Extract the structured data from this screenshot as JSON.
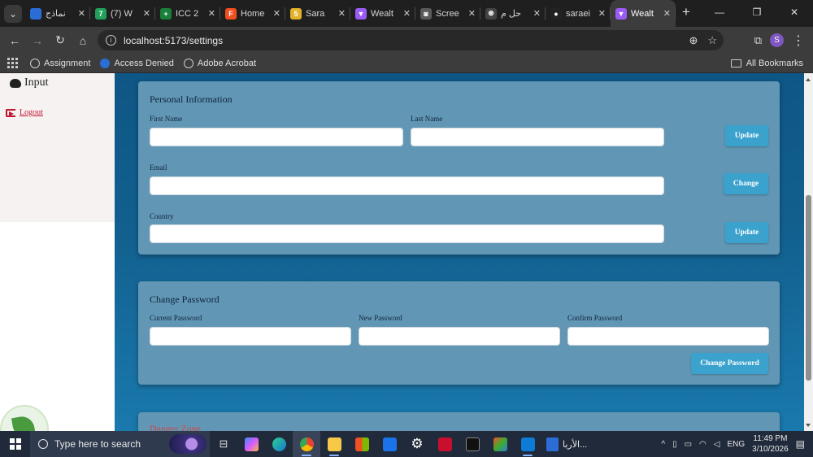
{
  "browser": {
    "tabs": [
      {
        "title": "نماذج",
        "favicon_color": "#2b6cd6",
        "favicon": "",
        "active": false
      },
      {
        "title": "(7) W",
        "favicon_color": "#22a05a",
        "favicon": "7",
        "active": false
      },
      {
        "title": "ICC 2",
        "favicon_color": "#188038",
        "favicon": "+",
        "active": false
      },
      {
        "title": "Home",
        "favicon_color": "#f24e1e",
        "favicon": "F",
        "active": false
      },
      {
        "title": "Sara",
        "favicon_color": "#e3b22a",
        "favicon": "5",
        "active": false
      },
      {
        "title": "Wealt",
        "favicon_color": "#9b5cf6",
        "favicon": "▼",
        "active": false
      },
      {
        "title": "Scree",
        "favicon_color": "#5a5a5a",
        "favicon": "◙",
        "active": false
      },
      {
        "title": "حل م",
        "favicon_color": "#444444",
        "favicon": "⊛",
        "active": false
      },
      {
        "title": "saraei",
        "favicon_color": "#222222",
        "favicon": "●",
        "active": false
      },
      {
        "title": "Wealt",
        "favicon_color": "#9b5cf6",
        "favicon": "▼",
        "active": true
      }
    ],
    "new_tab": "+",
    "close_glyph": "✕",
    "url": "localhost:5173/settings",
    "profile_initial": "S",
    "bookmarks": [
      {
        "label": "Assignment"
      },
      {
        "label": "Access Denied"
      },
      {
        "label": "Adobe Acrobat"
      }
    ],
    "all_bookmarks": "All Bookmarks"
  },
  "sidebar": {
    "input_label": "Input",
    "logout_label": "Logout"
  },
  "personal_info": {
    "title": "Personal Information",
    "first_name_label": "First Name",
    "last_name_label": "Last Name",
    "email_label": "Email",
    "country_label": "Country",
    "first_name_value": "",
    "last_name_value": "",
    "email_value": "",
    "country_value": "",
    "update_name_button": "Update",
    "change_email_button": "Change",
    "update_country_button": "Update"
  },
  "change_password": {
    "title": "Change Password",
    "current_label": "Current Password",
    "new_label": "New Password",
    "confirm_label": "Confirm Password",
    "submit_button": "Change Password"
  },
  "danger_zone": {
    "title": "Danger Zone"
  },
  "taskbar": {
    "search_placeholder": "Type here to search",
    "doc_label": "الأربا...",
    "language": "ENG",
    "time": "11:49 PM",
    "date": "3/10/2026"
  },
  "colors": {
    "accent_button": "#3aa2cd",
    "card_bg": "#6197b5",
    "danger": "#d14545"
  }
}
